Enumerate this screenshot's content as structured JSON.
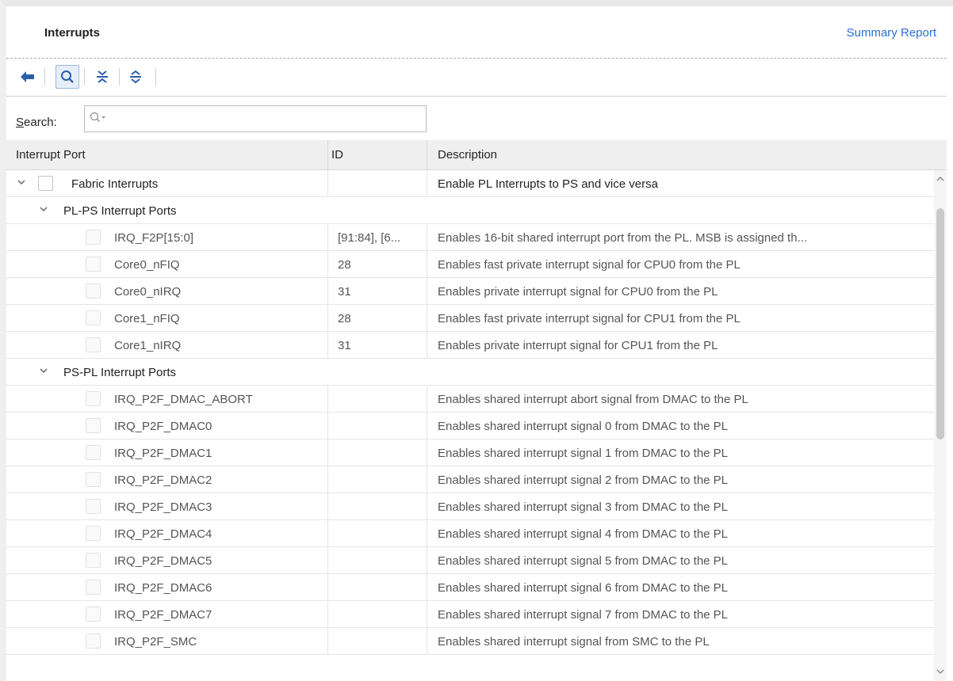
{
  "header": {
    "title": "Interrupts",
    "summary_link": "Summary Report"
  },
  "toolbar": {
    "buttons": [
      "back-icon",
      "search-icon",
      "collapse-all-icon",
      "expand-all-icon"
    ]
  },
  "search": {
    "label_prefix": "S",
    "label_rest": "earch:",
    "placeholder": "Q-",
    "value": ""
  },
  "columns": [
    "Interrupt Port",
    "ID",
    "Description"
  ],
  "rows": [
    {
      "port": "Fabric Interrupts",
      "id": "",
      "desc": "Enable PL Interrupts to PS and vice versa"
    },
    {
      "port": "PL-PS Interrupt Ports",
      "id": "",
      "desc": ""
    },
    {
      "port": "IRQ_F2P[15:0]",
      "id": "[91:84], [6...",
      "desc": "Enables 16-bit shared interrupt port from the PL. MSB is assigned th..."
    },
    {
      "port": "Core0_nFIQ",
      "id": "28",
      "desc": "Enables fast private interrupt signal for CPU0 from the PL"
    },
    {
      "port": "Core0_nIRQ",
      "id": "31",
      "desc": "Enables private interrupt signal for CPU0 from the PL"
    },
    {
      "port": "Core1_nFIQ",
      "id": "28",
      "desc": "Enables fast private interrupt signal for CPU1 from the PL"
    },
    {
      "port": "Core1_nIRQ",
      "id": "31",
      "desc": "Enables private interrupt signal for CPU1 from the PL"
    },
    {
      "port": "PS-PL Interrupt Ports",
      "id": "",
      "desc": ""
    },
    {
      "port": "IRQ_P2F_DMAC_ABORT",
      "id": "",
      "desc": "Enables shared interrupt abort signal from DMAC to the PL"
    },
    {
      "port": "IRQ_P2F_DMAC0",
      "id": "",
      "desc": "Enables shared interrupt signal 0 from DMAC to the PL"
    },
    {
      "port": "IRQ_P2F_DMAC1",
      "id": "",
      "desc": "Enables shared interrupt signal 1 from DMAC to the PL"
    },
    {
      "port": "IRQ_P2F_DMAC2",
      "id": "",
      "desc": "Enables shared interrupt signal 2 from DMAC to the PL"
    },
    {
      "port": "IRQ_P2F_DMAC3",
      "id": "",
      "desc": "Enables shared interrupt signal 3 from DMAC to the PL"
    },
    {
      "port": "IRQ_P2F_DMAC4",
      "id": "",
      "desc": "Enables shared interrupt signal 4 from DMAC to the PL"
    },
    {
      "port": "IRQ_P2F_DMAC5",
      "id": "",
      "desc": "Enables shared interrupt signal 5 from DMAC to the PL"
    },
    {
      "port": "IRQ_P2F_DMAC6",
      "id": "",
      "desc": "Enables shared interrupt signal 6 from DMAC to the PL"
    },
    {
      "port": "IRQ_P2F_DMAC7",
      "id": "",
      "desc": "Enables shared interrupt signal 7 from DMAC to the PL"
    },
    {
      "port": "IRQ_P2F_SMC",
      "id": "",
      "desc": "Enables shared interrupt signal from SMC to the PL"
    }
  ],
  "colors": {
    "link": "#2d6fd2",
    "toolbar_icon": "#2a5fa8",
    "header_bg": "#efefef"
  }
}
